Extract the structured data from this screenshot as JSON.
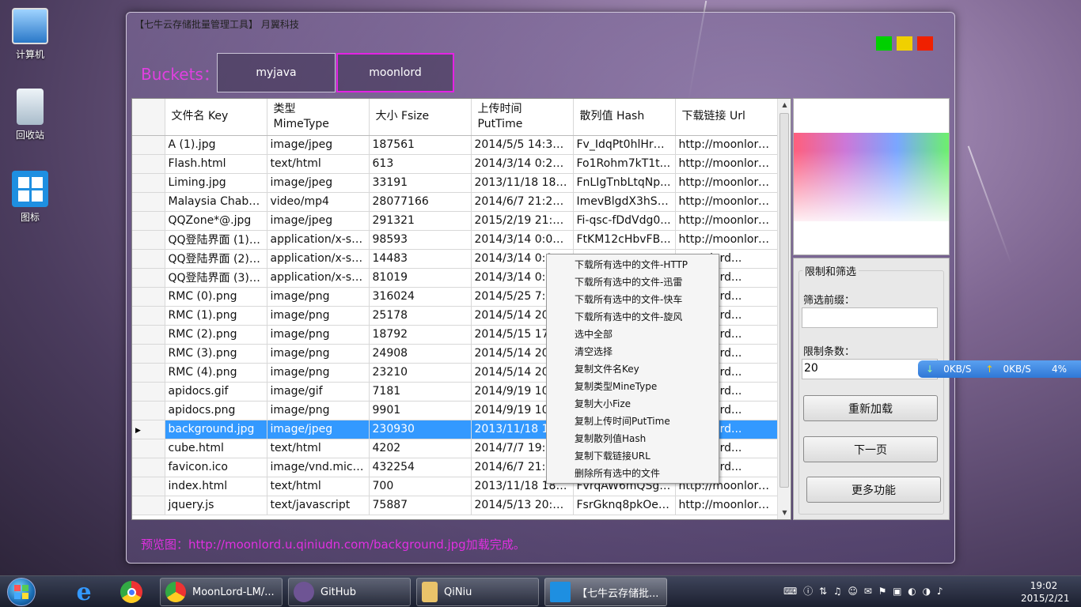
{
  "desktop": {
    "icons": [
      {
        "label": "计算机"
      },
      {
        "label": "回收站"
      },
      {
        "label": "图标"
      }
    ]
  },
  "app": {
    "title": "【七牛云存储批量管理工具】 月翼科技",
    "window_buttons": {
      "colors": [
        "#00d000",
        "#f0d000",
        "#f02000"
      ]
    },
    "buckets_label": "Buckets：",
    "bucket_tabs": [
      {
        "label": "myjava",
        "active": false
      },
      {
        "label": "moonlord",
        "active": true
      }
    ]
  },
  "grid": {
    "columns": [
      {
        "line1": "文件名 Key",
        "line2": ""
      },
      {
        "line1": "类型",
        "line2": "MimeType"
      },
      {
        "line1": "大小 Fsize",
        "line2": ""
      },
      {
        "line1": "上传时间",
        "line2": "PutTime"
      },
      {
        "line1": "散列值 Hash",
        "line2": ""
      },
      {
        "line1": "下载链接 Url",
        "line2": ""
      }
    ],
    "rows": [
      [
        "A (1).jpg",
        "image/jpeg",
        "187561",
        "2014/5/5 14:37:01",
        "Fv_IdqPt0hlHrw...",
        "http://moonlord..."
      ],
      [
        "Flash.html",
        "text/html",
        "613",
        "2014/3/14 0:25:30",
        "Fo1Rohm7kT1t...",
        "http://moonlord..."
      ],
      [
        "Liming.jpg",
        "image/jpeg",
        "33191",
        "2013/11/18 18:2...",
        "FnLIgTnbLtqNp...",
        "http://moonlord..."
      ],
      [
        "Malaysia Chaba...",
        "video/mp4",
        "28077166",
        "2014/6/7 21:29:04",
        "ImevBlgdX3hSN...",
        "http://moonlord..."
      ],
      [
        "QQZone*@.jpg",
        "image/jpeg",
        "291321",
        "2015/2/19 21:36:...",
        "Fi-qsc-fDdVdg0...",
        "http://moonlord..."
      ],
      [
        "QQ登陆界面 (1).s...",
        "application/x-sh...",
        "98593",
        "2014/3/14 0:08:13",
        "FtKM12cHbvFB...",
        "http://moonlord..."
      ],
      [
        "QQ登陆界面 (2).s...",
        "application/x-sh...",
        "14483",
        "2014/3/14 0:0",
        "",
        "moonlord..."
      ],
      [
        "QQ登陆界面 (3).s...",
        "application/x-sh...",
        "81019",
        "2014/3/14 0:0",
        "",
        "moonlord..."
      ],
      [
        "RMC (0).png",
        "image/png",
        "316024",
        "2014/5/25 7:5",
        "",
        "moonlord..."
      ],
      [
        "RMC (1).png",
        "image/png",
        "25178",
        "2014/5/14 20:",
        "",
        "moonlord..."
      ],
      [
        "RMC (2).png",
        "image/png",
        "18792",
        "2014/5/15 17:",
        "",
        "moonlord..."
      ],
      [
        "RMC (3).png",
        "image/png",
        "24908",
        "2014/5/14 20:",
        "",
        "moonlord..."
      ],
      [
        "RMC (4).png",
        "image/png",
        "23210",
        "2014/5/14 20:",
        "",
        "moonlord..."
      ],
      [
        "apidocs.gif",
        "image/gif",
        "7181",
        "2014/9/19 10:",
        "",
        "moonlord..."
      ],
      [
        "apidocs.png",
        "image/png",
        "9901",
        "2014/9/19 10:",
        "",
        "moonlord..."
      ],
      [
        "background.jpg",
        "image/jpeg",
        "230930",
        "2013/11/18 18",
        "",
        "moonlord..."
      ],
      [
        "cube.html",
        "text/html",
        "4202",
        "2014/7/7 19:2",
        "",
        "moonlord..."
      ],
      [
        "favicon.ico",
        "image/vnd.micr...",
        "432254",
        "2014/6/7 21:2",
        "",
        "moonlord..."
      ],
      [
        "index.html",
        "text/html",
        "700",
        "2013/11/18 18:2...",
        "FvrqAW6mQSgv...",
        "http://moonlord..."
      ],
      [
        "jquery.js",
        "text/javascript",
        "75887",
        "2014/5/13 20:47:...",
        "FsrGknq8pkOeB...",
        "http://moonlord..."
      ]
    ],
    "selected_row": 15
  },
  "filter": {
    "group_title": "限制和筛选",
    "prefix_label": "筛选前缀：",
    "prefix_value": "",
    "limit_label": "限制条数：",
    "limit_value": "20",
    "reload_button": "重新加载",
    "next_button": "下一页",
    "more_button": "更多功能"
  },
  "status_text": "预览图：http://moonlord.u.qiniudn.com/background.jpg加载完成。",
  "context_menu": {
    "items": [
      "下载所有选中的文件-HTTP",
      "下载所有选中的文件-迅雷",
      "下载所有选中的文件-快车",
      "下载所有选中的文件-旋风",
      "选中全部",
      "清空选择",
      "复制文件名Key",
      "复制类型MineType",
      "复制大小Fize",
      "复制上传时间PutTime",
      "复制散列值Hash",
      "复制下载链接URL",
      "删除所有选中的文件"
    ]
  },
  "netmon": {
    "down": "0KB/S",
    "up": "0KB/S",
    "cpu": "4%"
  },
  "taskbar": {
    "buttons": [
      {
        "label": "MoonLord-LM/..."
      },
      {
        "label": "GitHub"
      },
      {
        "label": "QiNiu"
      },
      {
        "label": "【七牛云存储批..."
      }
    ],
    "clock_time": "19:02",
    "clock_date": "2015/2/21"
  }
}
